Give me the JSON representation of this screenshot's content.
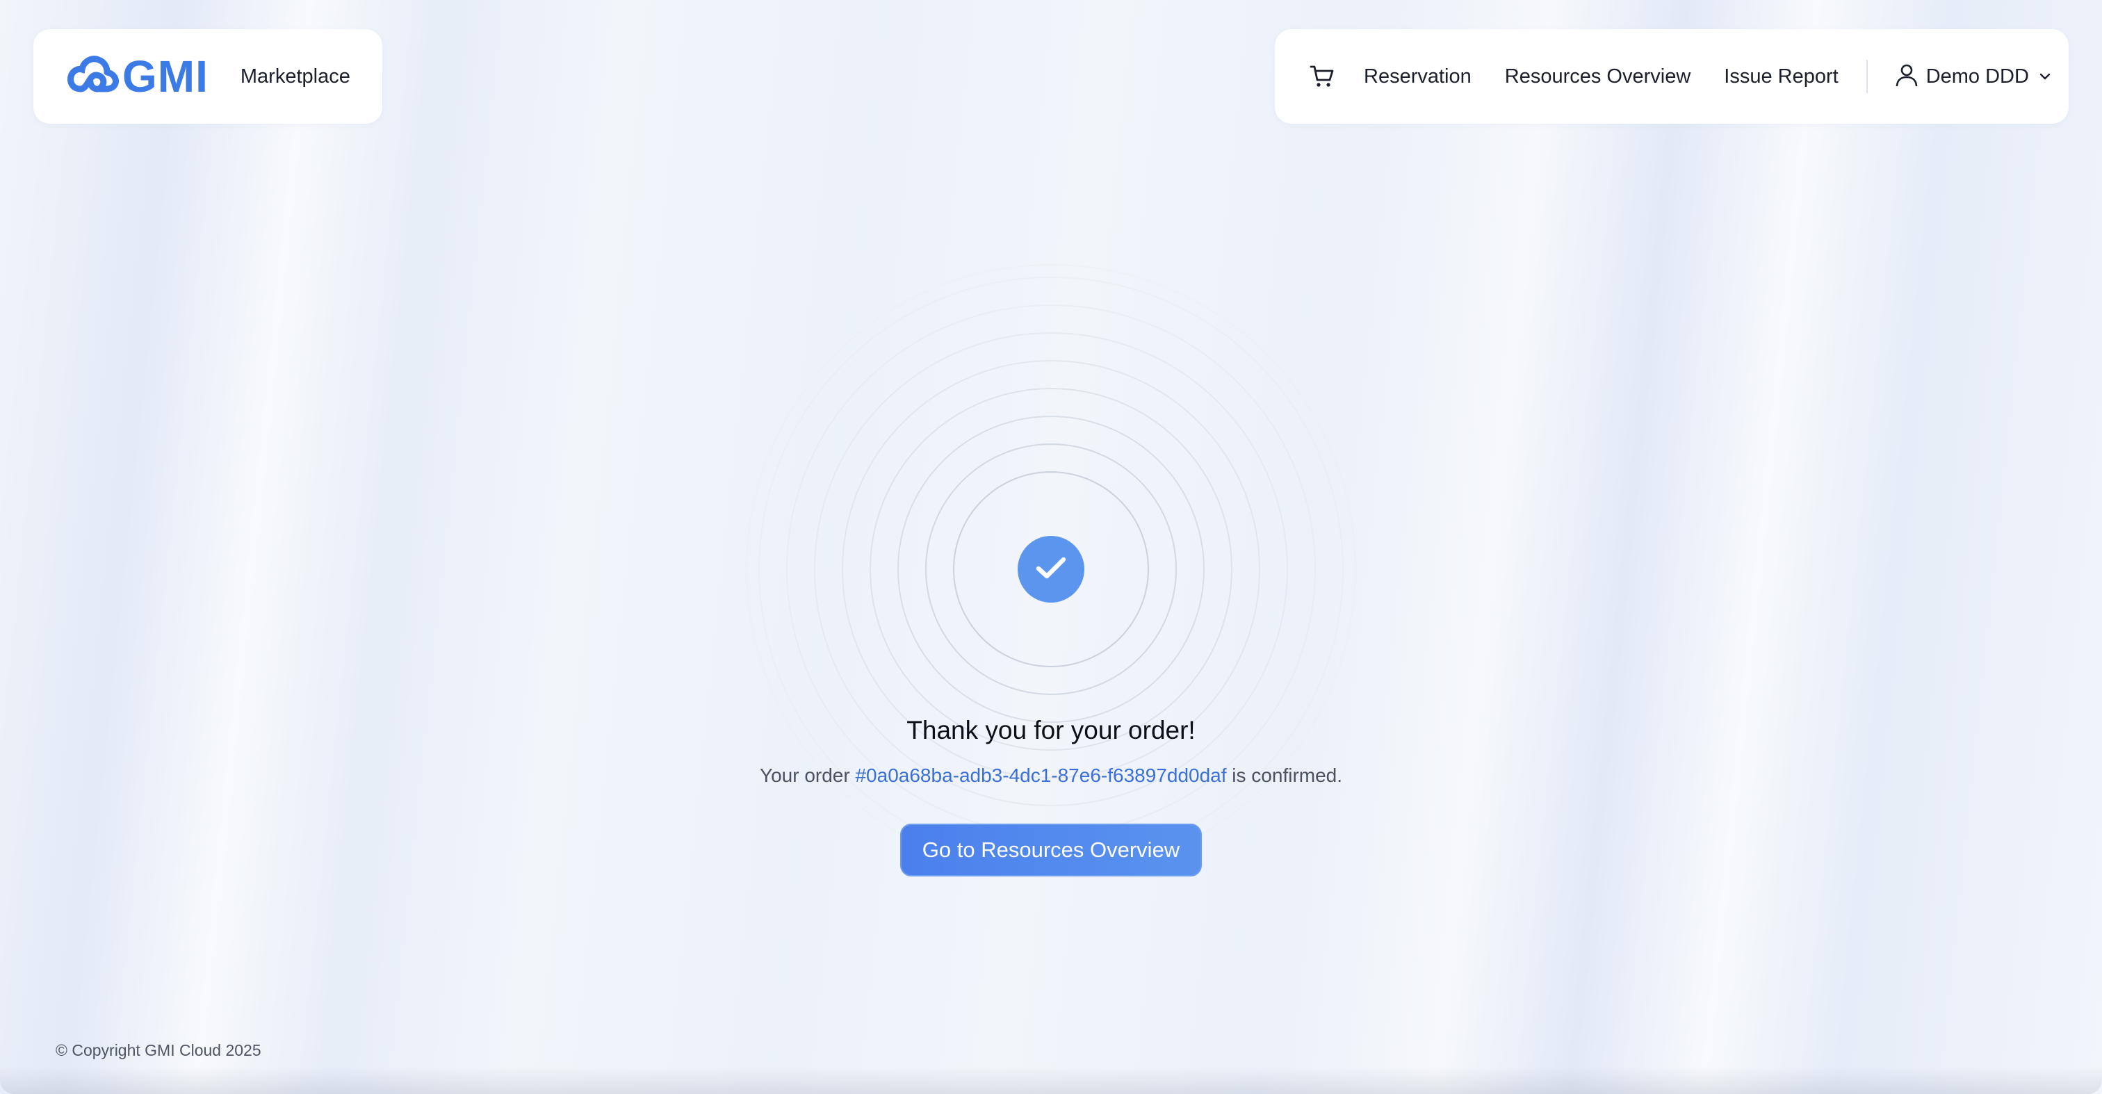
{
  "brand": {
    "logo_text": "GMI",
    "link_label": "Marketplace",
    "accent": "#3c7be6"
  },
  "nav": {
    "cart_icon": "shopping-cart-icon",
    "items": [
      {
        "label": "Reservation"
      },
      {
        "label": "Resources Overview"
      },
      {
        "label": "Issue Report"
      }
    ],
    "user": {
      "icon": "user-icon",
      "name": "Demo DDD",
      "dropdown_icon": "chevron-down-icon"
    }
  },
  "confirmation": {
    "icon": "check-icon",
    "title": "Thank you for your order!",
    "prefix": "Your order ",
    "order_id": "#0a0a68ba-adb3-4dc1-87e6-f63897dd0daf",
    "suffix": " is confirmed.",
    "button_label": "Go to Resources Overview",
    "accent": "#5b95ee"
  },
  "footer": {
    "copyright": "© Copyright GMI Cloud 2025"
  }
}
